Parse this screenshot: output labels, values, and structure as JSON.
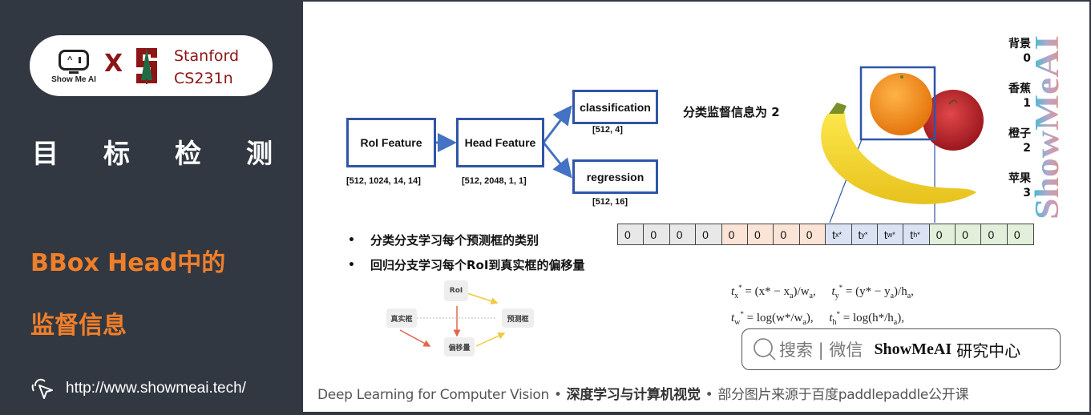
{
  "sidebar": {
    "logo": {
      "showmeai_text": "Show Me AI",
      "x_mark": "X",
      "partner_line1": "Stanford",
      "partner_line2": "CS231n"
    },
    "title_chars": [
      "目",
      "标",
      "检",
      "测"
    ],
    "subtitle_line1": "BBox Head中的",
    "subtitle_line2": "监督信息",
    "url": "http://www.showmeai.tech/"
  },
  "diagram": {
    "nodes": [
      {
        "label": "RoI Feature",
        "dims": "[512, 1024, 14, 14]"
      },
      {
        "label": "Head Feature",
        "dims": "[512, 2048, 1, 1]"
      },
      {
        "label": "classification",
        "dims": "[512, 4]"
      },
      {
        "label": "regression",
        "dims": "[512, 16]"
      }
    ],
    "classification_label": "分类监督信息为 2"
  },
  "legend": [
    {
      "name": "背景",
      "id": "0"
    },
    {
      "name": "香蕉",
      "id": "1"
    },
    {
      "name": "橙子",
      "id": "2"
    },
    {
      "name": "苹果",
      "id": "3"
    }
  ],
  "watermark": "ShowMeAI",
  "vector": {
    "cells": [
      {
        "text": "0",
        "group": "gray"
      },
      {
        "text": "0",
        "group": "gray"
      },
      {
        "text": "0",
        "group": "gray"
      },
      {
        "text": "0",
        "group": "gray"
      },
      {
        "text": "0",
        "group": "orange"
      },
      {
        "text": "0",
        "group": "orange"
      },
      {
        "text": "0",
        "group": "orange"
      },
      {
        "text": "0",
        "group": "orange"
      },
      {
        "text": "t",
        "sub": "x",
        "group": "blue"
      },
      {
        "text": "t",
        "sub": "y",
        "group": "blue"
      },
      {
        "text": "t",
        "sub": "w",
        "group": "blue"
      },
      {
        "text": "t",
        "sub": "h",
        "group": "blue"
      },
      {
        "text": "0",
        "group": "green"
      },
      {
        "text": "0",
        "group": "green"
      },
      {
        "text": "0",
        "group": "green"
      },
      {
        "text": "0",
        "group": "green"
      }
    ],
    "colors": {
      "gray": "#e8e8e8",
      "orange": "#fbe3d6",
      "blue": "#dae3f3",
      "green": "#e2efda"
    }
  },
  "bullets": [
    "分类分支学习每个预测框的类别",
    "回归分支学习每个RoI到真实框的偏移量"
  ],
  "mini_diagram": {
    "roi": "RoI",
    "gt_box": "真实框",
    "pred_box": "预测框",
    "offset": "偏移量"
  },
  "formula": {
    "line1_a": "= (x* − x",
    "line1_b": ")/w",
    "line1_c": "= (y* − y",
    "line1_d": ")/h",
    "line2_a": "= log(w*/w",
    "line2_c": "= log(h*/h"
  },
  "search": {
    "placeholder": "搜索 | 微信",
    "brand": "ShowMeAI",
    "brand_cn": "研究中心"
  },
  "footer": {
    "part1": "Deep Learning for Computer Vision",
    "sep": "•",
    "part2": "深度学习与计算机视觉",
    "part3": "部分图片来源于百度paddlepaddle公开课"
  },
  "colors": {
    "sidebar_bg": "#323842",
    "accent_orange": "#f07f2a",
    "stanford_red": "#8c1515",
    "diagram_blue": "#2f55a6"
  }
}
